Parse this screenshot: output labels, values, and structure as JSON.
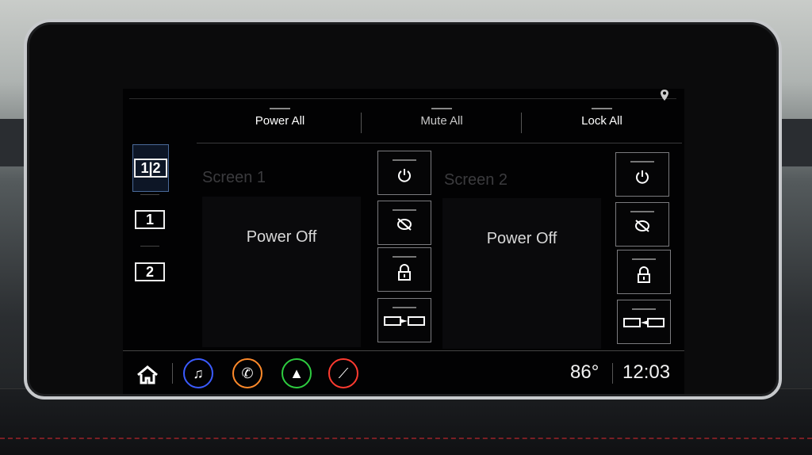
{
  "tabs": [
    "Power All",
    "Mute All",
    "Lock All"
  ],
  "modes": [
    {
      "label": "1|2",
      "icon": "split-screen-icon",
      "selected": true
    },
    {
      "label": "1",
      "icon": "screen-1-icon",
      "selected": false
    },
    {
      "label": "2",
      "icon": "screen-2-icon",
      "selected": false
    }
  ],
  "screens": [
    {
      "label": "Screen 1",
      "status": "Power Off"
    },
    {
      "label": "Screen 2",
      "status": "Power Off"
    }
  ],
  "controls": [
    "power-icon",
    "mute-icon",
    "lock-icon",
    "source-transfer-icon"
  ],
  "dock": {
    "apps": [
      {
        "name": "music-icon",
        "color": "#3b5bff"
      },
      {
        "name": "phone-icon",
        "color": "#ff8a2a"
      },
      {
        "name": "navigation-icon",
        "color": "#2ecc40"
      },
      {
        "name": "seat-icon",
        "color": "#ff3b30"
      }
    ],
    "temperature": "86°",
    "time": "12:03"
  }
}
